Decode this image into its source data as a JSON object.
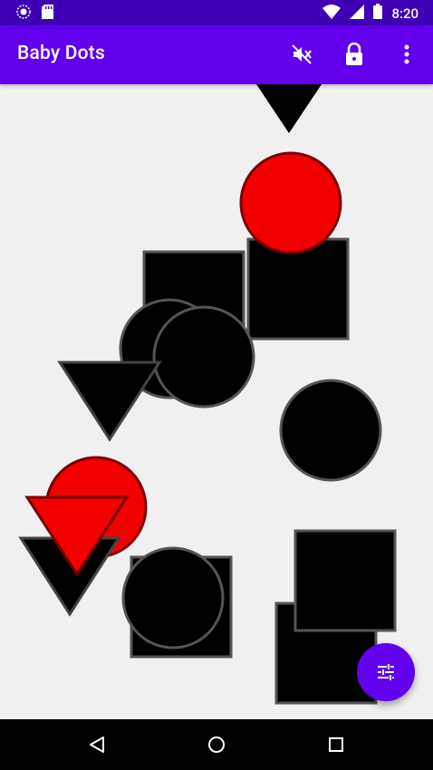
{
  "status_bar": {
    "time": "8:20",
    "icons": [
      "notification-circle-icon",
      "sd-card-icon",
      "wifi-icon",
      "signal-icon",
      "battery-icon"
    ]
  },
  "app_bar": {
    "title": "Baby Dots",
    "actions": [
      "mute-icon",
      "lock-icon",
      "more-vert-icon"
    ]
  },
  "fab": {
    "icon": "tune-sliders-icon"
  },
  "nav_bar": {
    "buttons": [
      "back-icon",
      "home-icon",
      "recents-icon"
    ]
  },
  "colors": {
    "status_bar": "#3f00b5",
    "app_bar": "#6200ee",
    "background": "#f0f0f0",
    "shape_black": "#000000",
    "shape_red": "#f20000",
    "shape_stroke": "#555555"
  }
}
